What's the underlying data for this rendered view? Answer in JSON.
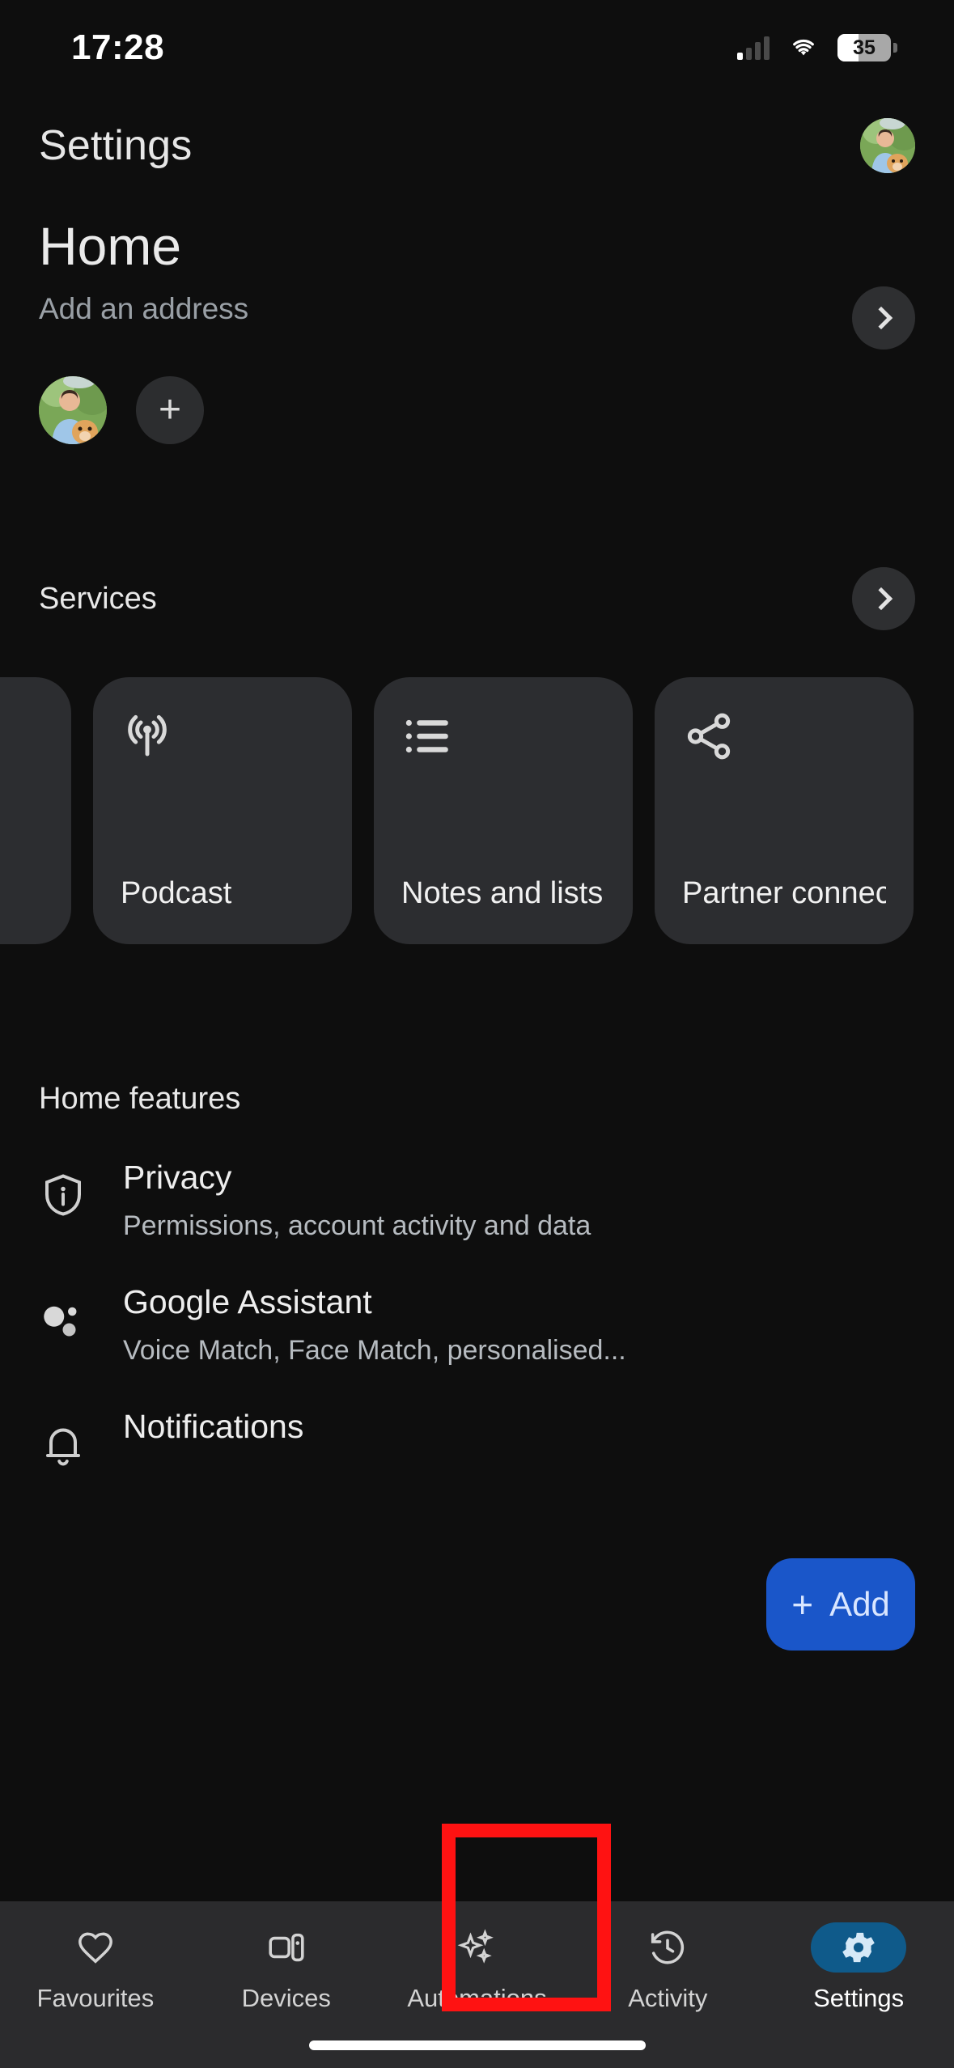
{
  "status_bar": {
    "time": "17:28",
    "signal_icon": "cellular-signal-icon",
    "wifi_icon": "wifi-icon",
    "battery_level": "35"
  },
  "app": {
    "title": "Settings",
    "account_avatar": "account-avatar"
  },
  "home": {
    "name": "Home",
    "address_placeholder": "Add an address",
    "chevron_icon": "chevron-right-icon",
    "members": [
      {
        "name": "member-avatar",
        "type": "photo"
      }
    ],
    "add_member_label": "+"
  },
  "services": {
    "title": "Services",
    "chevron_icon": "chevron-right-icon",
    "cards": [
      {
        "label": "",
        "icon": "partial-card"
      },
      {
        "label": "Podcast",
        "icon": "broadcast-icon"
      },
      {
        "label": "Notes and lists",
        "icon": "list-icon"
      },
      {
        "label": "Partner connecti...",
        "icon": "share-icon"
      }
    ]
  },
  "home_features": {
    "title": "Home features",
    "items": [
      {
        "name": "Privacy",
        "description": "Permissions, account activity and data",
        "icon": "shield-info-icon"
      },
      {
        "name": "Google Assistant",
        "description": "Voice Match, Face Match, personalised...",
        "icon": "assistant-dots-icon"
      },
      {
        "name": "Notifications",
        "description": "",
        "icon": "bell-icon"
      }
    ]
  },
  "fab": {
    "plus": "+",
    "label": "Add",
    "color": "#1a56c9"
  },
  "bottom_nav": {
    "active_index": 4,
    "active_pill_color": "#0f5a8a",
    "items": [
      {
        "label": "Favourites",
        "icon": "heart-icon"
      },
      {
        "label": "Devices",
        "icon": "devices-icon"
      },
      {
        "label": "Automations",
        "icon": "sparkle-icon"
      },
      {
        "label": "Activity",
        "icon": "history-icon"
      },
      {
        "label": "Settings",
        "icon": "gear-icon"
      }
    ]
  },
  "annotation": {
    "color": "#ff1212",
    "target": "Settings"
  }
}
